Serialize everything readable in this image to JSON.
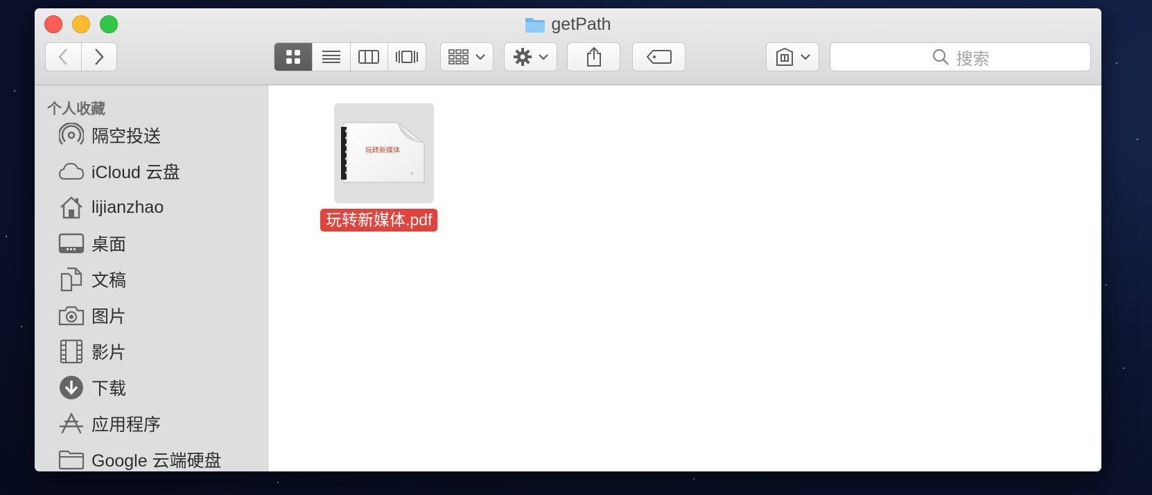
{
  "window": {
    "title": "getPath",
    "traffic_lights": [
      "close",
      "minimize",
      "zoom"
    ]
  },
  "toolbar": {
    "back_icon": "chevron-left-icon",
    "forward_icon": "chevron-right-icon",
    "view_modes": [
      "icon-view",
      "list-view",
      "column-view",
      "cover-flow-view"
    ],
    "active_view": "icon-view",
    "search_placeholder": "搜索"
  },
  "sidebar": {
    "section_title": "个人收藏",
    "items": [
      {
        "label": "隔空投送",
        "icon": "airdrop-icon"
      },
      {
        "label": "iCloud 云盘",
        "icon": "cloud-icon"
      },
      {
        "label": "lijianzhao",
        "icon": "home-icon"
      },
      {
        "label": "桌面",
        "icon": "desktop-icon"
      },
      {
        "label": "文稿",
        "icon": "documents-icon"
      },
      {
        "label": "图片",
        "icon": "camera-icon"
      },
      {
        "label": "影片",
        "icon": "film-icon"
      },
      {
        "label": "下载",
        "icon": "download-icon"
      },
      {
        "label": "应用程序",
        "icon": "applications-icon"
      },
      {
        "label": "Google 云端硬盘",
        "icon": "folder-icon"
      }
    ]
  },
  "content": {
    "files": [
      {
        "name": "玩转新媒体.pdf",
        "thumbnail_text": "玩转新媒体",
        "selected": true
      }
    ]
  },
  "colors": {
    "selection": "#e0453d",
    "sidebar_bg": "#dededf",
    "active_segment": "#5f5f5f"
  }
}
